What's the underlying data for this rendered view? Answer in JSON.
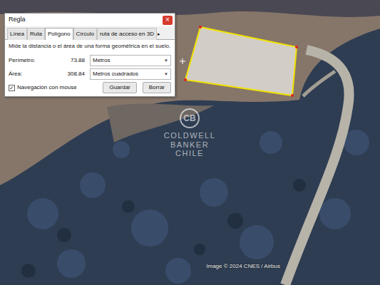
{
  "window": {
    "title": "Regla",
    "close": "×"
  },
  "tabs": [
    {
      "label": "Línea",
      "selected": false
    },
    {
      "label": "Ruta",
      "selected": false
    },
    {
      "label": "Polígono",
      "selected": true
    },
    {
      "label": "Círculo",
      "selected": false
    },
    {
      "label": "ruta de acceso en 3D",
      "selected": false
    }
  ],
  "tab_scroll": "▸",
  "description": "Mide la distancia o el área de una forma geométrica en el suelo.",
  "measurements": [
    {
      "label": "Perímetro:",
      "value": "73.88",
      "unit": "Metros"
    },
    {
      "label": "Área:",
      "value": "308.84",
      "unit": "Metros cuadrados"
    }
  ],
  "mouse_navigation": {
    "label": "Navegación con mouse",
    "checked": true
  },
  "buttons": [
    "Guardar",
    "Borrar"
  ],
  "map": {
    "logo": "CB",
    "watermark": [
      "COLDWELL",
      "BANKER",
      "CHILE"
    ],
    "attribution": "Image © 2024 CNES / Airbus"
  }
}
